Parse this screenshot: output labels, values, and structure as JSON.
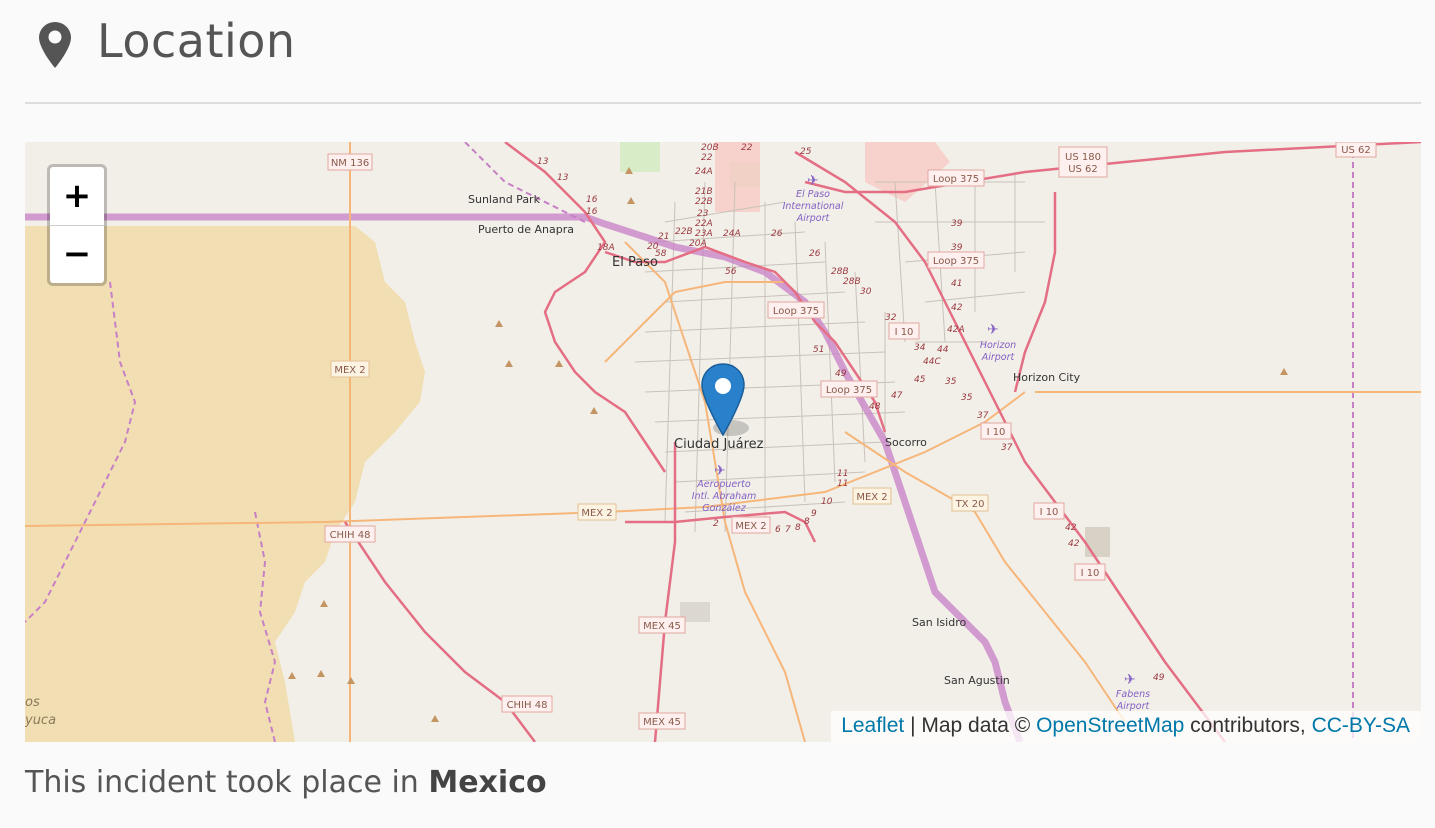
{
  "header": {
    "title": "Location",
    "icon": "map-marker-icon"
  },
  "map": {
    "zoom_in_label": "+",
    "zoom_out_label": "−",
    "marker_icon": "map-marker-icon",
    "place_labels": [
      "El Paso",
      "Ciudad Juárez",
      "Sunland Park",
      "Puerto de Anapra",
      "Horizon City",
      "Socorro",
      "San Isidro",
      "San Agustin"
    ],
    "airport_labels": [
      "El Paso International Airport",
      "Horizon Airport",
      "Aeropuerto Intl. Abraham González",
      "Fabens Airport"
    ],
    "road_shields": [
      "NM 136",
      "US 180",
      "US 62",
      "Loop 375",
      "I 10",
      "MEX 2",
      "MEX 45",
      "CHIH 48",
      "TX 20"
    ],
    "attribution": {
      "leaflet": "Leaflet",
      "separator": " | Map data © ",
      "osm": "OpenStreetMap",
      "contributors": " contributors, ",
      "license": "CC-BY-SA"
    },
    "colors": {
      "land": "#f2efe9",
      "desert": "#f1dfb3",
      "motorway": "#e892a2",
      "border": "#c77fc5",
      "link": "#0078a8"
    }
  },
  "caption": {
    "prefix": "This incident took place in ",
    "country": "Mexico"
  }
}
